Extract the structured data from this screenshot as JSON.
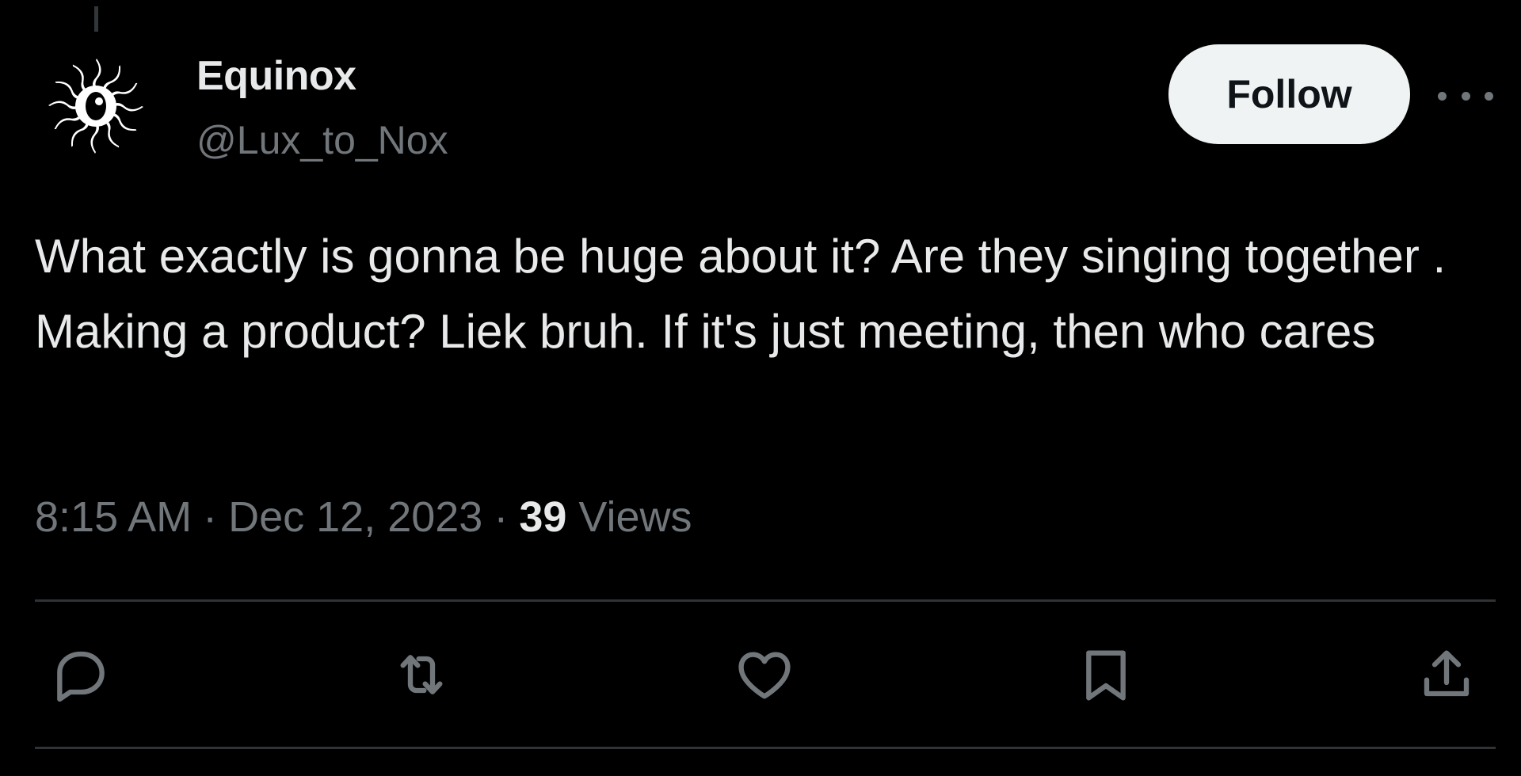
{
  "tweet": {
    "author": {
      "display_name": "Equinox",
      "handle": "@Lux_to_Nox",
      "avatar_icon": "sun-eye-icon"
    },
    "follow_label": "Follow",
    "more_icon": "more-dots-icon",
    "text": "What exactly is gonna be huge about it?  Are they singing together . Making a product? Liek bruh. If it's just meeting, then who cares",
    "time": "8:15 AM",
    "separator": "·",
    "date": "Dec 12, 2023",
    "views_count": "39",
    "views_label": "Views"
  },
  "actions": [
    {
      "icon": "reply-icon"
    },
    {
      "icon": "retweet-icon"
    },
    {
      "icon": "like-icon"
    },
    {
      "icon": "bookmark-icon"
    },
    {
      "icon": "share-icon"
    }
  ],
  "colors": {
    "background": "#000000",
    "text_primary": "#e7e9ea",
    "text_secondary": "#71767b",
    "follow_bg": "#eff3f4",
    "divider": "#2f3336"
  }
}
